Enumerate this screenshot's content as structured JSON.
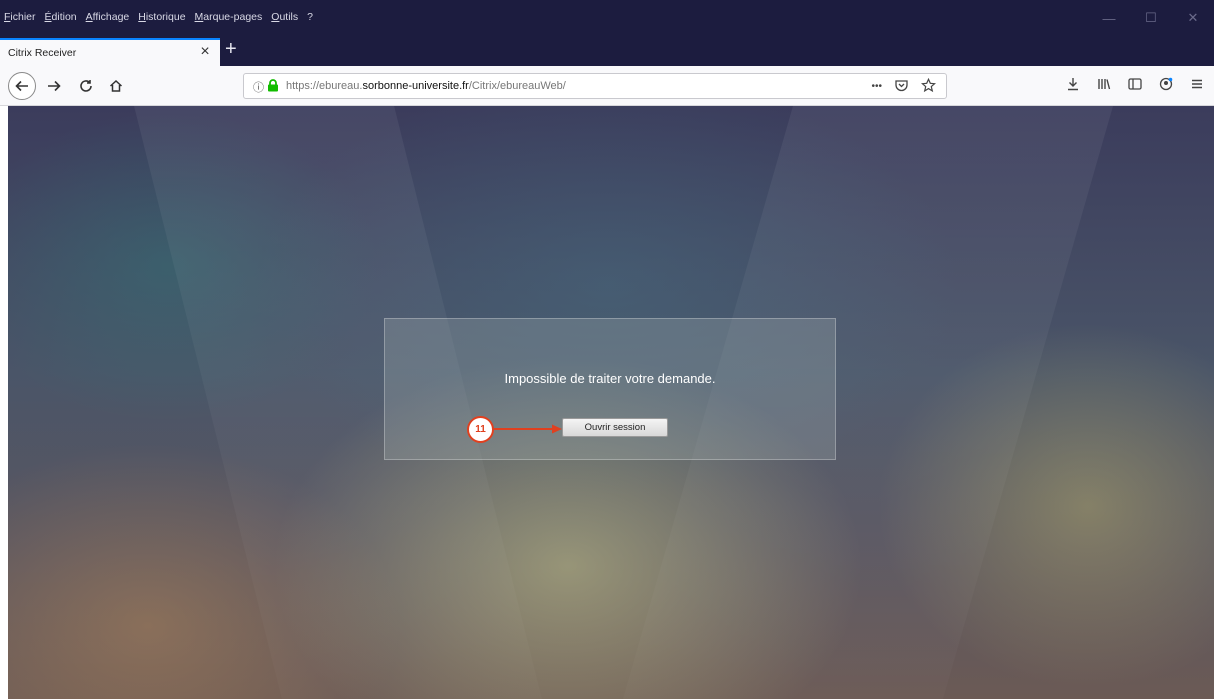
{
  "menu": [
    "Fichier",
    "Édition",
    "Affichage",
    "Historique",
    "Marque-pages",
    "Outils",
    "?"
  ],
  "window_controls": {
    "minimize": "—",
    "maximize": "☐",
    "close": "✕"
  },
  "tab": {
    "title": "Citrix Receiver",
    "close": "×"
  },
  "newtab": "+",
  "url": {
    "prefix": "https://ebureau.",
    "domain": "sorbonne-universite.fr",
    "path": "/Citrix/ebureauWeb/"
  },
  "url_actions": {
    "more": "•••"
  },
  "dialog": {
    "message": "Impossible de traiter votre demande.",
    "button": "Ouvrir session"
  },
  "annotation": {
    "step": "11",
    "color": "#e0401f"
  },
  "colors": {
    "menubar": "#1c1c3f",
    "accent": "#0a84ff",
    "lock": "#12bc00"
  }
}
